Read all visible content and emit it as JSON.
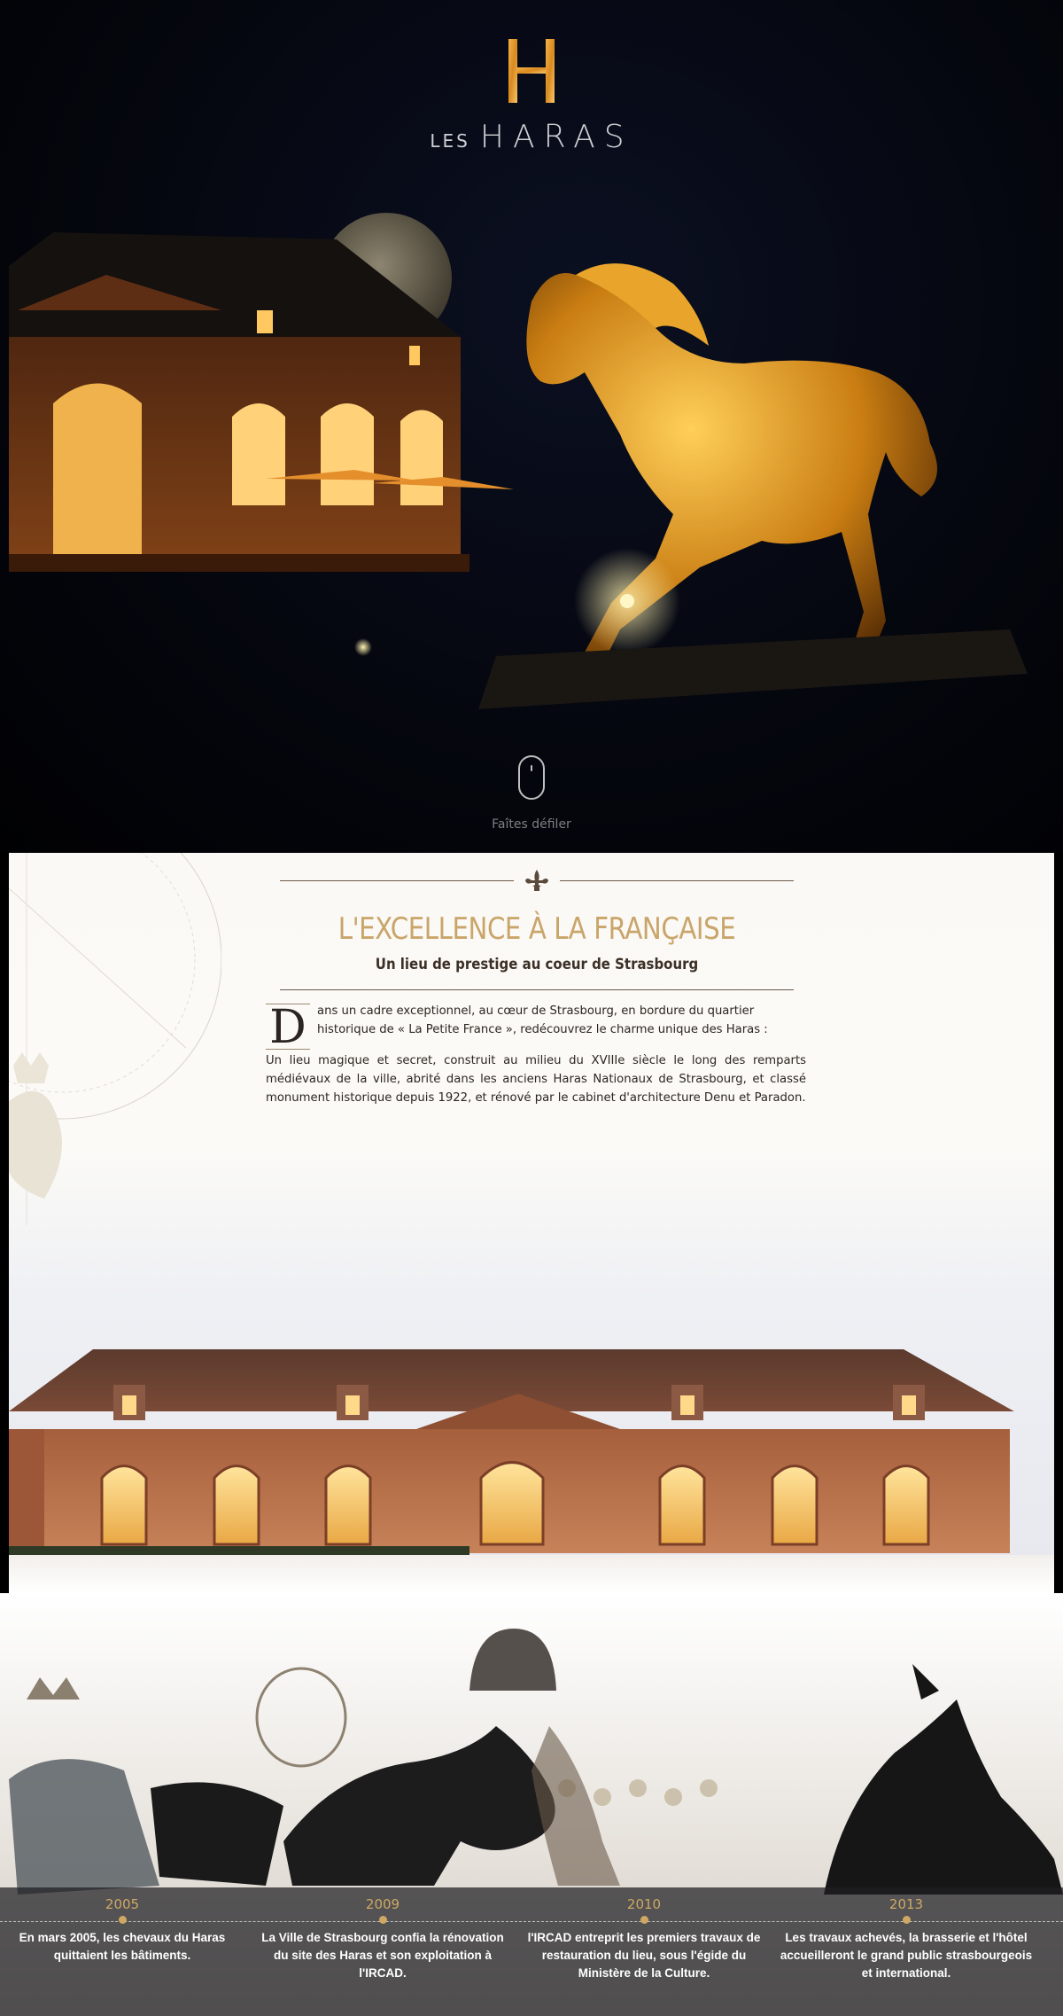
{
  "hero": {
    "logo_brand_prefix": "LES",
    "logo_brand_name": "HARAS",
    "scroll_label": "Faîtes défiler"
  },
  "intro": {
    "title": "L'EXCELLENCE À LA FRANÇAISE",
    "subtitle": "Un lieu de prestige au coeur de Strasbourg",
    "drop_cap": "D",
    "paragraph1": "ans un cadre exceptionnel, au cœur de Strasbourg, en bordure du quartier historique de « La Petite France », redécouvrez le charme unique des Haras :",
    "paragraph2": "Un lieu magique et secret, construit au milieu du XVIIIe siècle le long des remparts médiévaux de la ville, abrité dans les anciens Haras Nationaux de Strasbourg, et classé monument historique depuis 1922, et rénové par le cabinet d'architecture Denu et Paradon."
  },
  "timeline": [
    {
      "year": "2005",
      "text": "En mars 2005, les chevaux du Haras quittaient les bâtiments."
    },
    {
      "year": "2009",
      "text": "La Ville de Strasbourg confia la rénovation du site des Haras et son exploitation à l'IRCAD."
    },
    {
      "year": "2010",
      "text": "l'IRCAD entreprit les premiers travaux de restauration du lieu, sous l'égide du Ministère de la Culture."
    },
    {
      "year": "2013",
      "text": "Les travaux achevés, la brasserie et l'hôtel accueilleront le grand public strasbourgeois et international."
    }
  ],
  "colors": {
    "gold_accent": "#c9a56a",
    "hero_background": "#05070f",
    "intro_background": "#fbf9f5",
    "timeline_band": "#1e1e22"
  },
  "icons": {
    "logo": "h-monogram-icon",
    "scroll": "mouse-icon",
    "ornament": "fleur-de-lis-icon"
  }
}
